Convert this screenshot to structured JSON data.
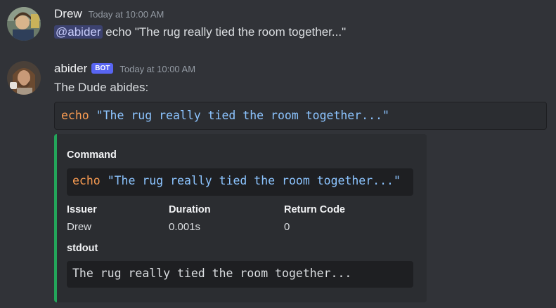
{
  "messages": [
    {
      "username": "Drew",
      "timestamp": "Today at 10:00 AM",
      "mention": "@abider",
      "text": " echo \"The rug really tied the room together...\""
    },
    {
      "username": "abider",
      "bot_tag": "BOT",
      "timestamp": "Today at 10:00 AM",
      "text": "The Dude abides:",
      "code": {
        "keyword": "echo",
        "string": "\"The rug really tied the room together...\""
      }
    }
  ],
  "embed": {
    "command_label": "Command",
    "command": {
      "keyword": "echo",
      "string": "\"The rug really tied the room together...\""
    },
    "fields": [
      {
        "name": "Issuer",
        "value": "Drew"
      },
      {
        "name": "Duration",
        "value": "0.001s"
      },
      {
        "name": "Return Code",
        "value": "0"
      }
    ],
    "stdout_label": "stdout",
    "stdout": "The rug really tied the room together...",
    "accent_color": "#23a55a"
  },
  "colors": {
    "background": "#313338",
    "mention_bg": "#3c4270",
    "bot_tag": "#5865f2"
  }
}
